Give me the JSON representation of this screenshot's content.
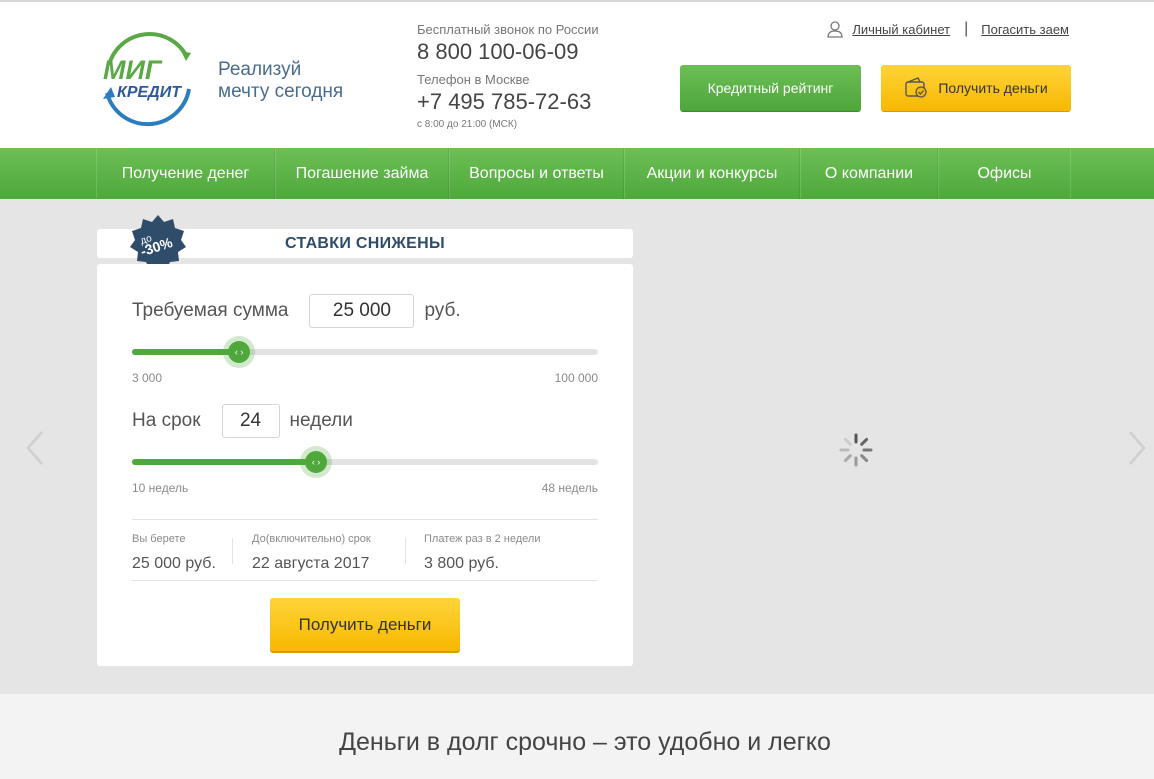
{
  "brand": {
    "logo_top": "МИГ",
    "logo_bottom": "КРЕДИТ",
    "tagline_line1": "Реализуй",
    "tagline_line2": "мечту сегодня"
  },
  "contacts": {
    "free_label": "Бесплатный звонок по России",
    "free_number": "8 800 100-06-09",
    "moscow_label": "Телефон в Москве",
    "moscow_number": "+7 495 785-72-63",
    "hours": "с 8:00 до 21:00 (МСК)"
  },
  "toplinks": {
    "cabinet": "Личный кабинет",
    "separator": "|",
    "repay": "Погасить заем"
  },
  "header_buttons": {
    "rating": "Кредитный рейтинг",
    "get_money": "Получить деньги"
  },
  "nav": [
    {
      "label": "Получение денег"
    },
    {
      "label": "Погашение займа"
    },
    {
      "label": "Вопросы и ответы"
    },
    {
      "label": "Акции и конкурсы"
    },
    {
      "label": "О компании"
    },
    {
      "label": "Офисы"
    }
  ],
  "promo": {
    "badge_top": "до",
    "badge_value": "-30%",
    "title": "СТАВКИ СНИЖЕНЫ"
  },
  "calculator": {
    "amount_label": "Требуемая сумма",
    "amount_value": "25 000",
    "amount_unit": "руб.",
    "amount_min": "3 000",
    "amount_max": "100 000",
    "amount_fraction": 0.23,
    "term_label": "На срок",
    "term_value": "24",
    "term_unit": "недели",
    "term_min": "10 недель",
    "term_max": "48 недель",
    "term_fraction": 0.395,
    "summary": [
      {
        "title": "Вы берете",
        "value": "25 000 руб."
      },
      {
        "title": "До(включительно) срок",
        "value": "22 августа 2017"
      },
      {
        "title": "Платеж раз в 2 недели",
        "value": "3 800 руб."
      }
    ],
    "submit": "Получить деньги"
  },
  "bottom": {
    "headline": "Деньги в долг срочно – это удобно и легко"
  },
  "colors": {
    "green": "#4ea83b",
    "yellow": "#f7b800",
    "navy": "#2f4d6b"
  }
}
